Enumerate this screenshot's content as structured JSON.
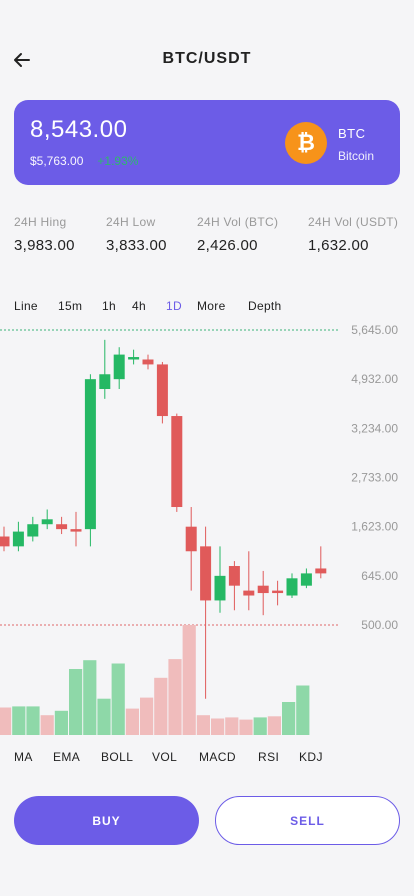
{
  "header": {
    "title": "BTC/USDT",
    "back_icon": "arrow-left-icon"
  },
  "price_card": {
    "price": "8,543.00",
    "sub_price": "$5,763.00",
    "change": "+1.93%",
    "coin_symbol": "BTC",
    "coin_name": "Bitcoin",
    "coin_icon": "bitcoin-icon",
    "coin_glyph": "₿"
  },
  "stats": [
    {
      "label": "24H Hing",
      "value": "3,983.00"
    },
    {
      "label": "24H Low",
      "value": "3,833.00"
    },
    {
      "label": "24H Vol (BTC)",
      "value": "2,426.00"
    },
    {
      "label": "24H Vol (USDT)",
      "value": "1,632.00"
    }
  ],
  "tabs": [
    {
      "label": "Line",
      "active": false
    },
    {
      "label": "15m",
      "active": false
    },
    {
      "label": "1h",
      "active": false
    },
    {
      "label": "4h",
      "active": false
    },
    {
      "label": "1D",
      "active": true
    },
    {
      "label": "More",
      "active": false
    },
    {
      "label": "Depth",
      "active": false
    }
  ],
  "indicators": [
    "MA",
    "EMA",
    "BOLL",
    "VOL",
    "MACD",
    "RSI",
    "KDJ"
  ],
  "actions": {
    "buy": "BUY",
    "sell": "SELL"
  },
  "colors": {
    "accent": "#6c5ce7",
    "up": "#25b864",
    "down": "#e05a5a",
    "up_volume": "#8ed8a8",
    "down_volume": "#f0bcbc",
    "bitcoin": "#f7931a",
    "high_line": "#3cb37a",
    "low_line": "#e06868",
    "axis_text": "#999999"
  },
  "chart_data": {
    "type": "candlestick",
    "y_tick_labels": [
      "5,645.00",
      "4,932.00",
      "3,234.00",
      "2,733.00",
      "1,623.00",
      "645.00",
      "500.00"
    ],
    "high_line_label": "5,645.00",
    "low_line_label": "500.00",
    "note_scale": "tick labels are evenly spaced and non-linear; candle values expressed on the tick-index scale (0 = 500.00, 6 = 5,645.00)",
    "candles": [
      {
        "o": 1.8,
        "c": 1.6,
        "h": 2.0,
        "l": 1.5
      },
      {
        "o": 1.6,
        "c": 1.9,
        "h": 2.1,
        "l": 1.5
      },
      {
        "o": 1.8,
        "c": 2.05,
        "h": 2.2,
        "l": 1.7
      },
      {
        "o": 2.05,
        "c": 2.15,
        "h": 2.35,
        "l": 1.95
      },
      {
        "o": 2.05,
        "c": 1.95,
        "h": 2.2,
        "l": 1.85
      },
      {
        "o": 1.95,
        "c": 1.9,
        "h": 2.3,
        "l": 1.6
      },
      {
        "o": 1.95,
        "c": 5.0,
        "h": 5.1,
        "l": 1.6
      },
      {
        "o": 4.8,
        "c": 5.1,
        "h": 5.8,
        "l": 4.6
      },
      {
        "o": 5.0,
        "c": 5.5,
        "h": 5.65,
        "l": 4.8
      },
      {
        "o": 5.4,
        "c": 5.45,
        "h": 5.6,
        "l": 5.3
      },
      {
        "o": 5.4,
        "c": 5.3,
        "h": 5.5,
        "l": 5.2
      },
      {
        "o": 5.3,
        "c": 4.25,
        "h": 5.35,
        "l": 4.1
      },
      {
        "o": 4.25,
        "c": 2.4,
        "h": 4.3,
        "l": 2.3
      },
      {
        "o": 2.0,
        "c": 1.5,
        "h": 2.4,
        "l": 0.7
      },
      {
        "o": 1.6,
        "c": 0.5,
        "h": 2.0,
        "l": -1.5
      },
      {
        "o": 0.5,
        "c": 1.0,
        "h": 1.6,
        "l": 0.25
      },
      {
        "o": 1.2,
        "c": 0.8,
        "h": 1.3,
        "l": 0.3
      },
      {
        "o": 0.7,
        "c": 0.6,
        "h": 1.5,
        "l": 0.3
      },
      {
        "o": 0.8,
        "c": 0.65,
        "h": 1.1,
        "l": 0.2
      },
      {
        "o": 0.7,
        "c": 0.65,
        "h": 0.9,
        "l": 0.4
      },
      {
        "o": 0.6,
        "c": 0.95,
        "h": 1.05,
        "l": 0.55
      },
      {
        "o": 0.8,
        "c": 1.05,
        "h": 1.15,
        "l": 0.75
      },
      {
        "o": 1.15,
        "c": 1.05,
        "h": 1.6,
        "l": 0.95
      }
    ],
    "volume": [
      {
        "v": 0.25,
        "up": false
      },
      {
        "v": 0.26,
        "up": true
      },
      {
        "v": 0.26,
        "up": true
      },
      {
        "v": 0.18,
        "up": false
      },
      {
        "v": 0.22,
        "up": true
      },
      {
        "v": 0.6,
        "up": true
      },
      {
        "v": 0.68,
        "up": true
      },
      {
        "v": 0.33,
        "up": true
      },
      {
        "v": 0.65,
        "up": true
      },
      {
        "v": 0.24,
        "up": false
      },
      {
        "v": 0.34,
        "up": false
      },
      {
        "v": 0.52,
        "up": false
      },
      {
        "v": 0.69,
        "up": false
      },
      {
        "v": 1.0,
        "up": false
      },
      {
        "v": 0.18,
        "up": false
      },
      {
        "v": 0.15,
        "up": false
      },
      {
        "v": 0.16,
        "up": false
      },
      {
        "v": 0.14,
        "up": false
      },
      {
        "v": 0.16,
        "up": true
      },
      {
        "v": 0.17,
        "up": false
      },
      {
        "v": 0.3,
        "up": true
      },
      {
        "v": 0.45,
        "up": true
      }
    ]
  }
}
